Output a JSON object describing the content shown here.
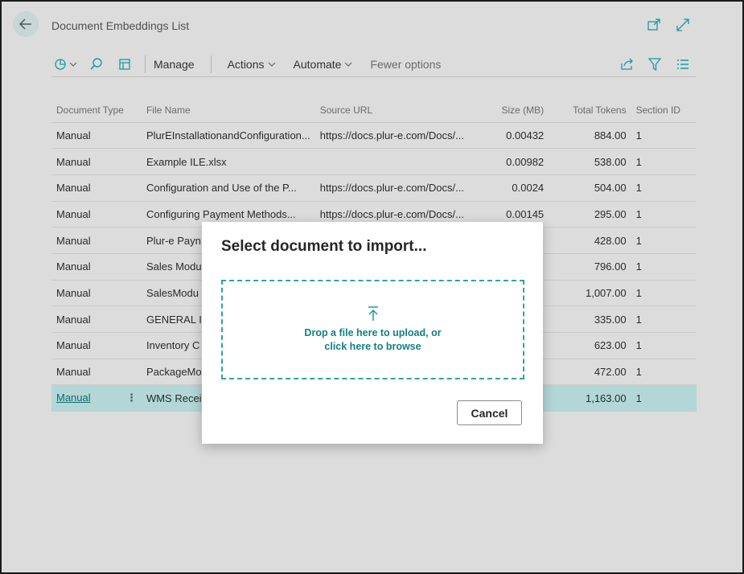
{
  "page": {
    "title": "Document Embeddings List"
  },
  "toolbar": {
    "manage": "Manage",
    "actions": "Actions",
    "automate": "Automate",
    "fewer_options": "Fewer options"
  },
  "columns": [
    "Document Type",
    "File Name",
    "Source URL",
    "Size (MB)",
    "Total Tokens",
    "Section ID"
  ],
  "rows": [
    {
      "doc_type": "Manual",
      "file_name": "PlurEInstallationandConfiguration...",
      "source_url": "https://docs.plur-e.com/Docs/...",
      "size": "0.00432",
      "tokens": "884.00",
      "section": "1"
    },
    {
      "doc_type": "Manual",
      "file_name": "Example ILE.xlsx",
      "source_url": "",
      "size": "0.00982",
      "tokens": "538.00",
      "section": "1"
    },
    {
      "doc_type": "Manual",
      "file_name": "Configuration and Use of the P...",
      "source_url": "https://docs.plur-e.com/Docs/...",
      "size": "0.0024",
      "tokens": "504.00",
      "section": "1"
    },
    {
      "doc_type": "Manual",
      "file_name": "Configuring Payment Methods...",
      "source_url": "https://docs.plur-e.com/Docs/...",
      "size": "0.00145",
      "tokens": "295.00",
      "section": "1"
    },
    {
      "doc_type": "Manual",
      "file_name": "Plur-e Payn",
      "source_url": "",
      "size": "",
      "tokens": "428.00",
      "section": "1"
    },
    {
      "doc_type": "Manual",
      "file_name": "Sales Modu",
      "source_url": "",
      "size": "",
      "tokens": "796.00",
      "section": "1"
    },
    {
      "doc_type": "Manual",
      "file_name": "SalesModu",
      "source_url": "",
      "size": "",
      "tokens": "1,007.00",
      "section": "1"
    },
    {
      "doc_type": "Manual",
      "file_name": "GENERAL I",
      "source_url": "",
      "size": "",
      "tokens": "335.00",
      "section": "1"
    },
    {
      "doc_type": "Manual",
      "file_name": "Inventory C",
      "source_url": "",
      "size": "",
      "tokens": "623.00",
      "section": "1"
    },
    {
      "doc_type": "Manual",
      "file_name": "PackageMo",
      "source_url": "",
      "size": "",
      "tokens": "472.00",
      "section": "1"
    },
    {
      "doc_type": "Manual",
      "file_name": "WMS Recei",
      "source_url": "",
      "size": "",
      "tokens": "1,163.00",
      "section": "1"
    }
  ],
  "dialog": {
    "title": "Select document to import...",
    "drop_line1": "Drop a file here to upload, or",
    "drop_line2": "click here to browse",
    "cancel": "Cancel"
  },
  "colors": {
    "accent": "#1a9b9c",
    "selected_row": "#b3d7d7",
    "backdrop": "#dcdcdc"
  },
  "icons": [
    "back-arrow-icon",
    "open-in-new-window-icon",
    "expand-icon",
    "analysis-icon",
    "search-icon",
    "edit-list-icon",
    "share-icon",
    "filter-icon",
    "list-view-icon",
    "upload-icon",
    "row-menu-icon"
  ]
}
